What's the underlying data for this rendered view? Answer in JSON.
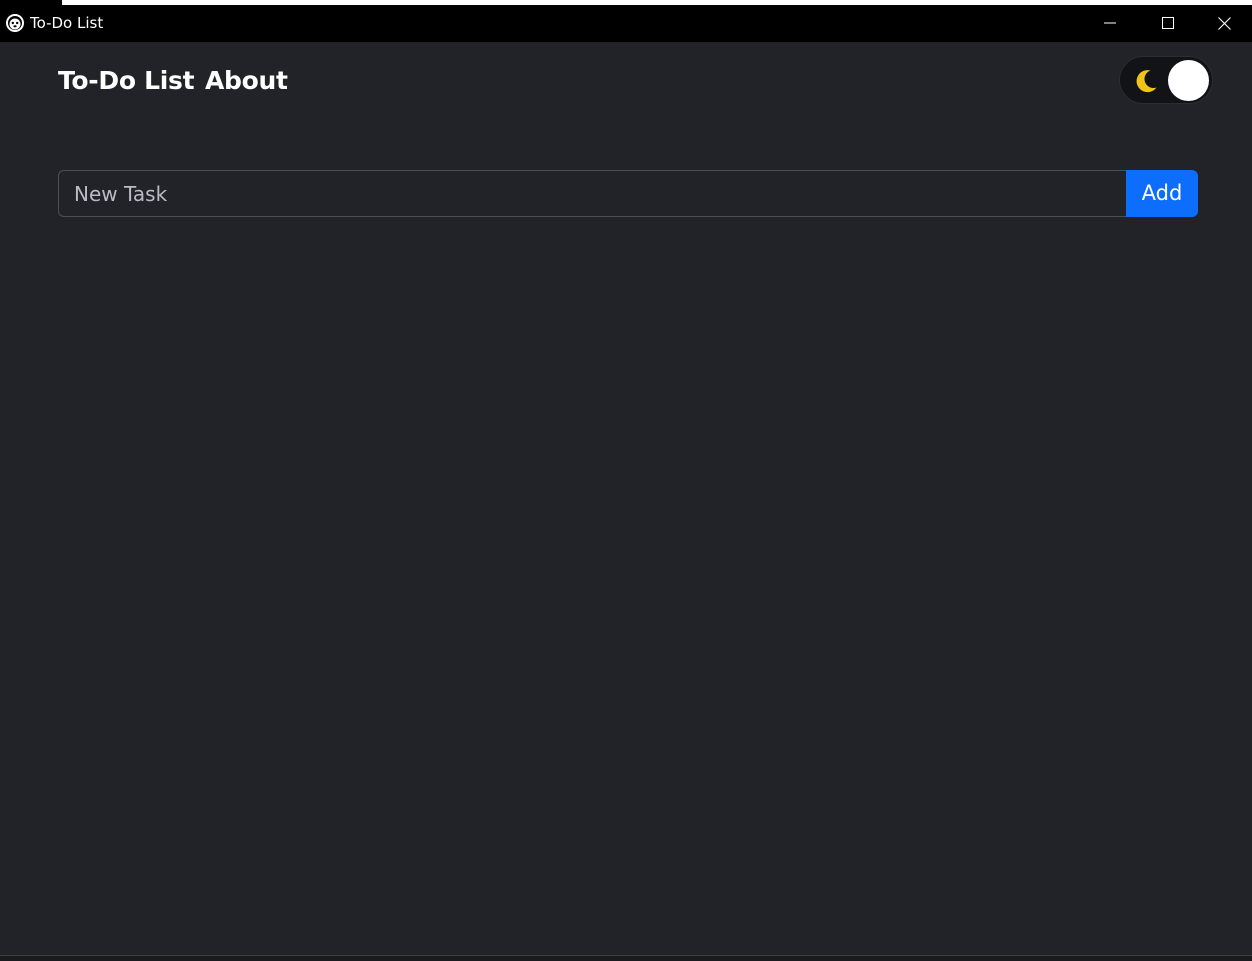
{
  "window": {
    "title": "To-Do List",
    "icon": "app-face-icon",
    "controls": {
      "minimize_icon": "minimize-icon",
      "maximize_icon": "maximize-icon",
      "close_icon": "close-icon"
    }
  },
  "navbar": {
    "brand": "To-Do List",
    "about": "About"
  },
  "theme_toggle": {
    "icon": "moon-icon",
    "state": "dark",
    "icon_color": "#f0c419"
  },
  "task_form": {
    "placeholder": "New Task",
    "value": "",
    "add_label": "Add"
  },
  "colors": {
    "background": "#212328",
    "titlebar": "#000000",
    "accent": "#0d6efd",
    "text": "#ffffff"
  }
}
